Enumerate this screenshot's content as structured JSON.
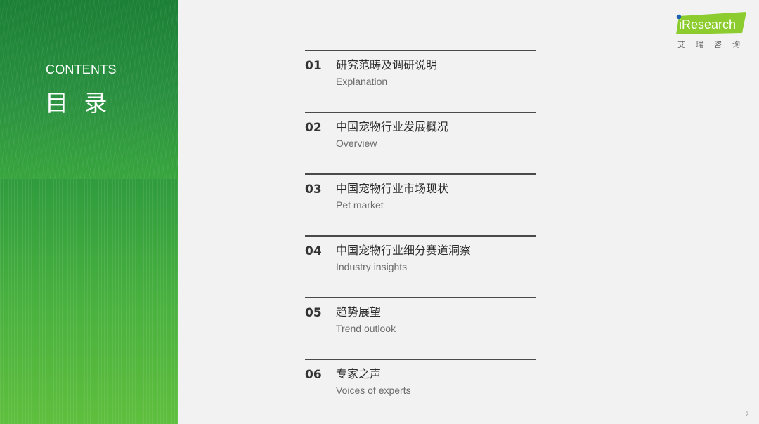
{
  "sidebar": {
    "contents_label": "CONTENTS",
    "title": "目 录",
    "colors": {
      "top": "#1f8a3a",
      "bottom": "#5fbf3e"
    }
  },
  "logo": {
    "brand": "iResearch",
    "brand_i": "i",
    "brand_rest": "Research",
    "chinese": [
      "艾",
      "瑞",
      "咨",
      "询"
    ],
    "colors": {
      "badge": "#8ccc2e",
      "dot": "#1d5fb4",
      "text": "#ffffff"
    }
  },
  "toc": {
    "items": [
      {
        "num": "01",
        "cn": "研究范畴及调研说明",
        "en": "Explanation"
      },
      {
        "num": "02",
        "cn": "中国宠物行业发展概况",
        "en": "Overview"
      },
      {
        "num": "03",
        "cn": "中国宠物行业市场现状",
        "en": "Pet market"
      },
      {
        "num": "04",
        "cn": "中国宠物行业细分赛道洞察",
        "en": "Industry insights"
      },
      {
        "num": "05",
        "cn": "趋势展望",
        "en": "Trend outlook"
      },
      {
        "num": "06",
        "cn": "专家之声",
        "en": "Voices of experts"
      }
    ]
  },
  "page_number": "2"
}
